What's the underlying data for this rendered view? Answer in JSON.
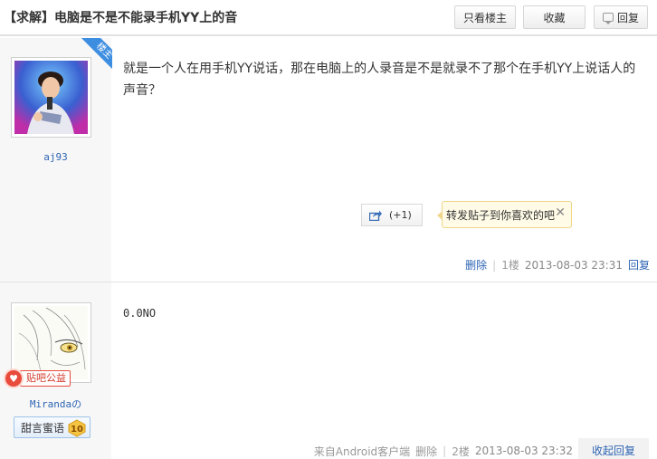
{
  "header": {
    "title": "【求解】电脑是不是不能录手机YY上的音",
    "btn_only_owner": "只看楼主",
    "btn_collect": "收藏",
    "btn_reply": "回复"
  },
  "posts": [
    {
      "username": "aj93",
      "owner_badge": "楼主",
      "content": "就是一个人在用手机YY说话，那在电脑上的人录音是不是就录不了那个在手机YY上说话人的声音？",
      "share_count": "(+1)",
      "share_tip": "转发贴子到你喜欢的吧",
      "delete": "删除",
      "floor": "1楼",
      "time": "2013-08-03 23:31",
      "reply": "回复"
    },
    {
      "username": "Mirandaの",
      "badge_gongyi": "贴吧公益",
      "tag_label": "甜言蜜语",
      "level": "10",
      "content": "0.0NO",
      "source": "来自Android客户端",
      "delete": "删除",
      "floor": "2楼",
      "time": "2013-08-03 23:32",
      "fold_reply": "收起回复"
    }
  ],
  "colors": {
    "link": "#2d64b3",
    "owner_ribbon": "#3d8ee0",
    "gongyi_red": "#e84b3c",
    "level_gold": "#f5c542"
  }
}
